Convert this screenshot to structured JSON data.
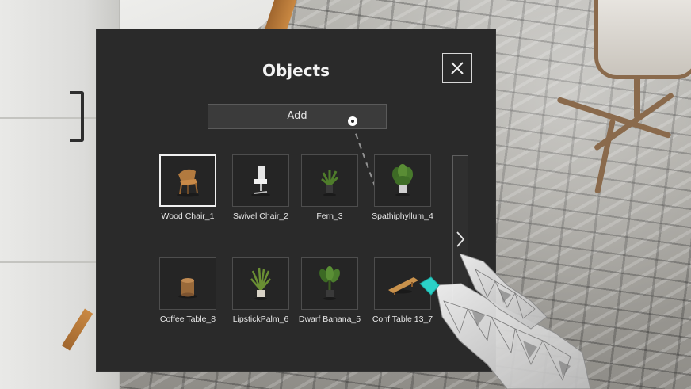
{
  "panel": {
    "title": "Objects",
    "add_label": "Add"
  },
  "objects": [
    {
      "label": "Wood Chair_1",
      "icon": "wood-chair-icon",
      "selected": true
    },
    {
      "label": "Swivel Chair_2",
      "icon": "swivel-chair-icon",
      "selected": false
    },
    {
      "label": "Fern_3",
      "icon": "fern-icon",
      "selected": false
    },
    {
      "label": "Spathiphyllum_4",
      "icon": "spathiphyllum-icon",
      "selected": false
    },
    {
      "label": "Coffee Table_8",
      "icon": "coffee-table-icon",
      "selected": false
    },
    {
      "label": "LipstickPalm_6",
      "icon": "lipstick-palm-icon",
      "selected": false
    },
    {
      "label": "Dwarf Banana_5",
      "icon": "dwarf-banana-icon",
      "selected": false
    },
    {
      "label": "Conf Table 13_7",
      "icon": "conf-table-icon",
      "selected": false
    }
  ],
  "colors": {
    "panel_bg": "#2a2a2a",
    "accent": "#2bd1c7"
  }
}
